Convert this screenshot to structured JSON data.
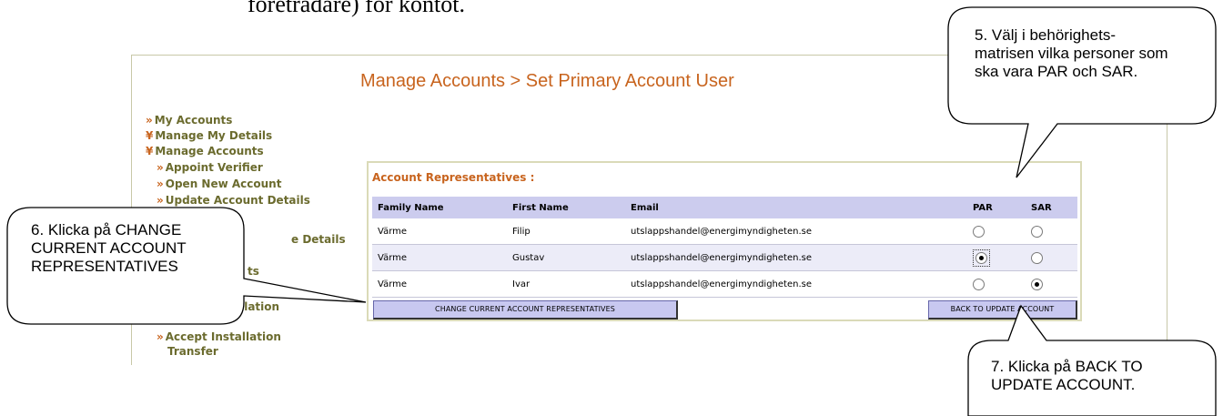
{
  "document_snippet": "företrädare) för kontot.",
  "page_title": "Manage Accounts > Set Primary Account User",
  "nav": {
    "my_accounts": "My Accounts",
    "manage_my_details": "Manage My Details",
    "manage_accounts": "Manage Accounts",
    "appoint_verifier": "Appoint Verifier",
    "open_new_account": "Open New Account",
    "update_account_details": "Update Account Details",
    "partial_details": "e Details",
    "partial_ts": "ts",
    "partial_allation": "allation",
    "accept_installation_transfer_1": "Accept Installation",
    "accept_installation_transfer_2": "Transfer"
  },
  "panel": {
    "title": "Account Representatives :",
    "columns": [
      "Family Name",
      "First Name",
      "Email",
      "PAR",
      "SAR"
    ],
    "rows": [
      {
        "family": "Värme",
        "first": "Filip",
        "email": "utslappshandel@energimyndigheten.se",
        "par": false,
        "sar": false
      },
      {
        "family": "Värme",
        "first": "Gustav",
        "email": "utslappshandel@energimyndigheten.se",
        "par": true,
        "sar": false
      },
      {
        "family": "Värme",
        "first": "Ivar",
        "email": "utslappshandel@energimyndigheten.se",
        "par": false,
        "sar": true
      }
    ],
    "change_button": "Change Current Account Representatives",
    "back_button": "Back To Update Account"
  },
  "callouts": {
    "c5": "5. Välj i behörighets-matrisen vilka personer som ska vara PAR och SAR.",
    "c6": "6. Klicka på CHANGE CURRENT ACCOUNT REPRESENTATIVES",
    "c7": "7. Klicka på BACK TO UPDATE ACCOUNT."
  },
  "colors": {
    "accent": "#c8641e",
    "nav": "#6b6b2e",
    "table_header": "#ccccee"
  }
}
